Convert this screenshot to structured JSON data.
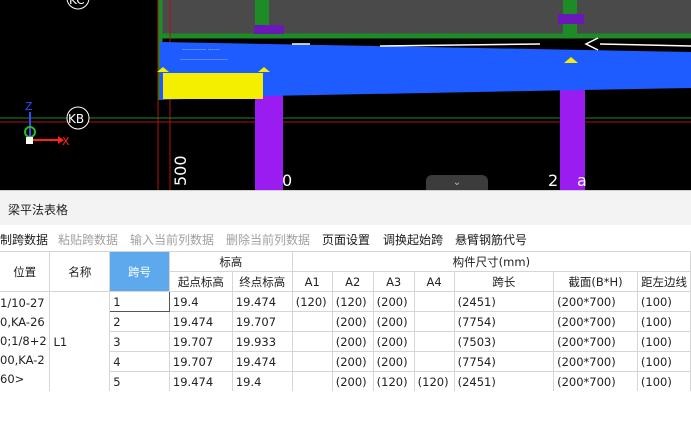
{
  "viewport": {
    "axis_top": "KC",
    "axis_bottom": "KB",
    "dim_left": "500",
    "dim_mid": "0",
    "dim_right": "2",
    "dim_right2": "a",
    "z_label": "Z",
    "x_label": "X",
    "collapse_glyph": "⌄"
  },
  "panel": {
    "title": "梁平法表格"
  },
  "toolbar": {
    "items": [
      "制跨数据",
      "粘贴跨数据",
      "输入当前列数据",
      "删除当前列数据",
      "页面设置",
      "调换起始跨",
      "悬臂钢筋代号"
    ]
  },
  "table": {
    "headers": {
      "position": "位置",
      "name": "名称",
      "span": "跨号",
      "elevation": "标高",
      "start_elev": "起点标高",
      "end_elev": "终点标高",
      "component_size": "构件尺寸(mm)",
      "a1": "A1",
      "a2": "A2",
      "a3": "A3",
      "a4": "A4",
      "span_len": "跨长",
      "section": "截面(B*H)",
      "dist_edge": "距左边线"
    },
    "position_lines": [
      "1/10-27",
      "0,KA-26",
      "0;1/8+2",
      "00,KA-2",
      "60>"
    ],
    "beam_name": "L1",
    "rows": [
      {
        "idx": "1",
        "start": "19.4",
        "end": "19.474",
        "a1": "(120)",
        "a2": "(120)",
        "a3": "(200)",
        "a4": "",
        "len": "(2451)",
        "sec": "(200*700)",
        "dist": "(100)"
      },
      {
        "idx": "2",
        "start": "19.474",
        "end": "19.707",
        "a1": "",
        "a2": "(200)",
        "a3": "(200)",
        "a4": "",
        "len": "(7754)",
        "sec": "(200*700)",
        "dist": "(100)"
      },
      {
        "idx": "3",
        "start": "19.707",
        "end": "19.933",
        "a1": "",
        "a2": "(200)",
        "a3": "(200)",
        "a4": "",
        "len": "(7503)",
        "sec": "(200*700)",
        "dist": "(100)"
      },
      {
        "idx": "4",
        "start": "19.707",
        "end": "19.474",
        "a1": "",
        "a2": "(200)",
        "a3": "(200)",
        "a4": "",
        "len": "(7754)",
        "sec": "(200*700)",
        "dist": "(100)"
      },
      {
        "idx": "5",
        "start": "19.474",
        "end": "19.4",
        "a1": "",
        "a2": "(200)",
        "a3": "(120)",
        "a4": "(120)",
        "len": "(2451)",
        "sec": "(200*700)",
        "dist": "(100)"
      }
    ]
  },
  "colors": {
    "beam_blue": "#1f5cff",
    "column_purple": "#9b1cf0",
    "green_frame": "#1d8c26",
    "selected_yellow": "#f4ee00",
    "header_selected": "#5ea9ee"
  }
}
